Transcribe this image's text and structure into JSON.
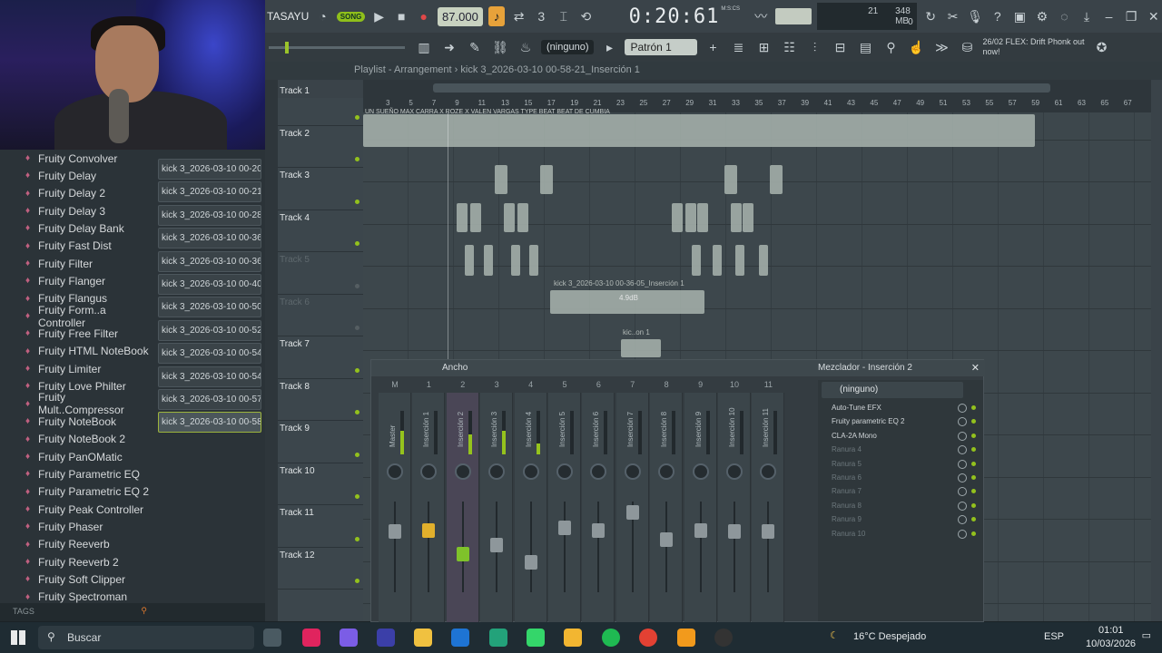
{
  "window": {
    "title_fragment": "TASAYU",
    "tempo": "87.000",
    "song_mode": "SONG",
    "clock": "0:20:61",
    "clock_label": "M:S:CS",
    "cpu_voices": "21",
    "ram": "348 MB",
    "cpu_zero": "0",
    "pattern": "Patrón 1",
    "snap": "(ninguno)",
    "news": "26/02  FLEX: Drift Phonk out now!"
  },
  "browser": {
    "plugins": [
      "Fruity Convolver",
      "Fruity Delay",
      "Fruity Delay 2",
      "Fruity Delay 3",
      "Fruity Delay Bank",
      "Fruity Fast Dist",
      "Fruity Filter",
      "Fruity Flanger",
      "Fruity Flangus",
      "Fruity Form..a Controller",
      "Fruity Free Filter",
      "Fruity HTML NoteBook",
      "Fruity Limiter",
      "Fruity Love Philter",
      "Fruity Mult..Compressor",
      "Fruity NoteBook",
      "Fruity NoteBook 2",
      "Fruity PanOMatic",
      "Fruity Parametric EQ",
      "Fruity Parametric EQ 2",
      "Fruity Peak Controller",
      "Fruity Phaser",
      "Fruity Reeverb",
      "Fruity Reeverb 2",
      "Fruity Soft Clipper",
      "Fruity Spectroman"
    ],
    "samples": [
      "kick 3_2026-03-10 00-20...",
      "kick 3_2026-03-10 00-21...",
      "kick 3_2026-03-10 00-28...",
      "kick 3_2026-03-10 00-36...",
      "kick 3_2026-03-10 00-36...",
      "kick 3_2026-03-10 00-40...",
      "kick 3_2026-03-10 00-50...",
      "kick 3_2026-03-10 00-52...",
      "kick 3_2026-03-10 00-54...",
      "kick 3_2026-03-10 00-54...",
      "kick 3_2026-03-10 00-57...",
      "kick 3_2026-03-10 00-58..."
    ],
    "tags_label": "TAGS"
  },
  "playlist": {
    "title": "Playlist - Arrangement",
    "clip_title": "kick 3_2026-03-10 00-58-21_Inserción 1",
    "ruler": [
      "3",
      "5",
      "7",
      "9",
      "11",
      "13",
      "15",
      "17",
      "19",
      "21",
      "23",
      "25",
      "27",
      "29",
      "31",
      "33",
      "35",
      "37",
      "39",
      "41",
      "43",
      "45",
      "47",
      "49",
      "51",
      "53",
      "55",
      "57",
      "59",
      "61",
      "63",
      "65",
      "67"
    ],
    "tracks": [
      "Track 1",
      "Track 2",
      "Track 3",
      "Track 4",
      "Track 5",
      "Track 6",
      "Track 7",
      "Track 8",
      "Track 9",
      "Track 10",
      "Track 11",
      "Track 12"
    ],
    "clip1_label": "UN SUEÑO MAX CARRA X ROZE X VALEN VARGAS TYPE BEAT BEAT DE CUMBIA",
    "clip5_label": "kick 3_2026-03-10 00-36-05_Inserción 1",
    "clip5_db": "4.9dB",
    "clip6_label": "kic..on 1"
  },
  "mixer": {
    "header": "Ancho",
    "title": "Mezclador - Inserción 2",
    "preset": "(ninguno)",
    "channels": [
      "M",
      "1",
      "2",
      "3",
      "4",
      "5",
      "6",
      "7",
      "8",
      "9",
      "10",
      "11"
    ],
    "channel_names": [
      "Master",
      "Inserción 1",
      "Inserción 2",
      "Inserción 3",
      "Inserción 4",
      "Inserción 5",
      "Inserción 6",
      "Inserción 7",
      "Inserción 8",
      "Inserción 9",
      "Inserción 10",
      "Inserción 11"
    ],
    "slots": [
      "Auto-Tune EFX",
      "Fruity parametric EQ 2",
      "CLA-2A Mono",
      "Ranura 4",
      "Ranura 5",
      "Ranura 6",
      "Ranura 7",
      "Ranura 8",
      "Ranura 9",
      "Ranura 10"
    ]
  },
  "taskbar": {
    "search": "Buscar",
    "weather": "16°C  Despejado",
    "lang": "ESP",
    "time": "01:01",
    "date": "10/03/2026"
  }
}
